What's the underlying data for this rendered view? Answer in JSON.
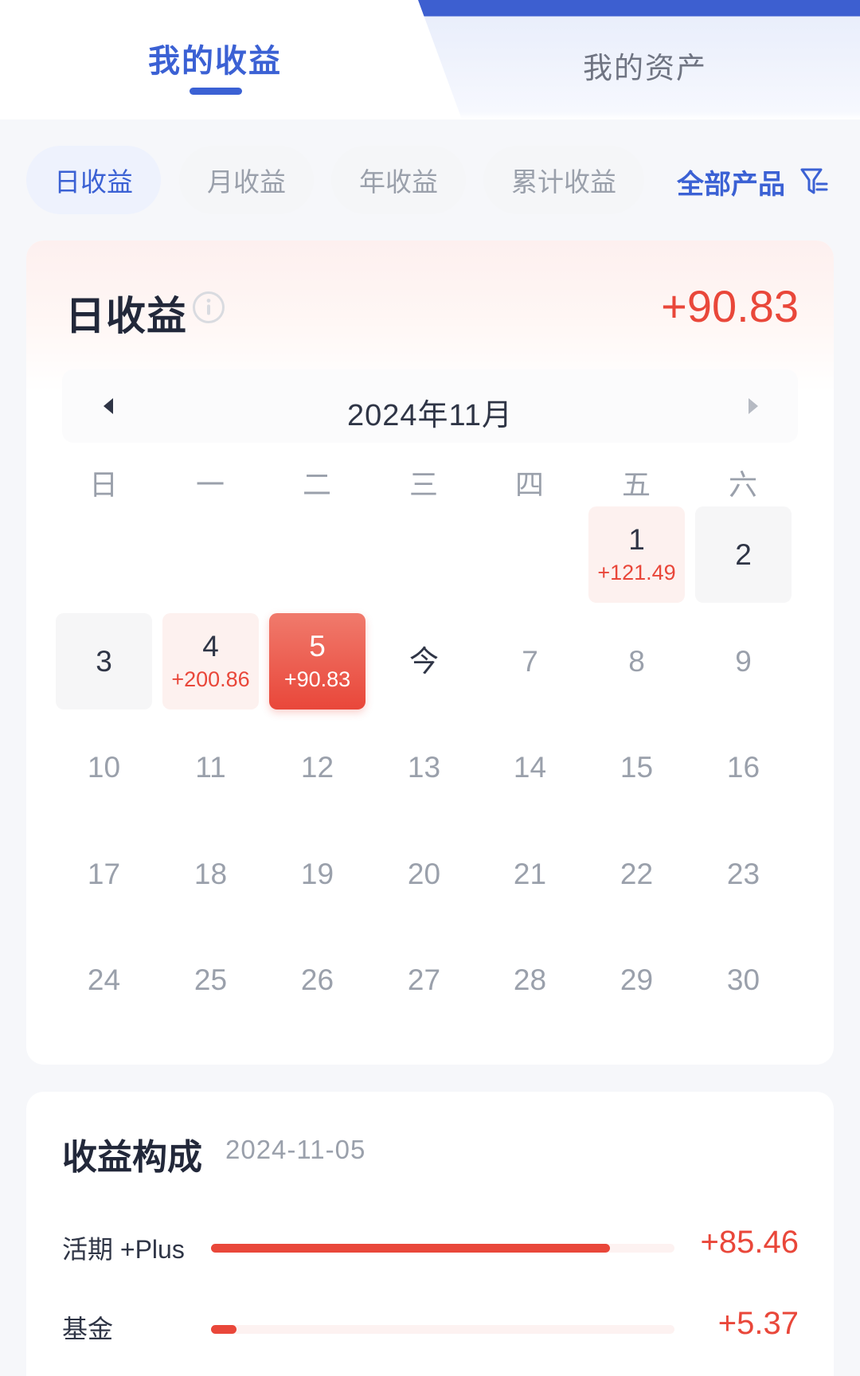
{
  "tabs": {
    "earnings": "我的收益",
    "assets": "我的资产"
  },
  "periods": [
    "日收益",
    "月收益",
    "年收益",
    "累计收益"
  ],
  "filter_label": "全部产品",
  "calendar_card": {
    "title": "日收益",
    "total": "+90.83",
    "month": "2024年11月",
    "weekdays": [
      "日",
      "一",
      "二",
      "三",
      "四",
      "五",
      "六"
    ],
    "days": [
      {
        "num": "1",
        "amount": "+121.49"
      },
      {
        "num": "2",
        "amount": ""
      },
      {
        "num": "3",
        "amount": ""
      },
      {
        "num": "4",
        "amount": "+200.86"
      },
      {
        "num": "5",
        "amount": "+90.83"
      },
      {
        "num": "今",
        "amount": ""
      },
      {
        "num": "7"
      },
      {
        "num": "8"
      },
      {
        "num": "9"
      },
      {
        "num": "10"
      },
      {
        "num": "11"
      },
      {
        "num": "12"
      },
      {
        "num": "13"
      },
      {
        "num": "14"
      },
      {
        "num": "15"
      },
      {
        "num": "16"
      },
      {
        "num": "17"
      },
      {
        "num": "18"
      },
      {
        "num": "19"
      },
      {
        "num": "20"
      },
      {
        "num": "21"
      },
      {
        "num": "22"
      },
      {
        "num": "23"
      },
      {
        "num": "24"
      },
      {
        "num": "25"
      },
      {
        "num": "26"
      },
      {
        "num": "27"
      },
      {
        "num": "28"
      },
      {
        "num": "29"
      },
      {
        "num": "30"
      }
    ]
  },
  "composition": {
    "title": "收益构成",
    "date": "2024-11-05",
    "items": [
      {
        "label": "活期 +Plus",
        "value": "+85.46",
        "share": 0.86
      },
      {
        "label": "基金",
        "value": "+5.37",
        "share": 0.055
      }
    ]
  },
  "colors": {
    "accent_blue": "#3b61d4",
    "earn_red": "#e9473a"
  }
}
